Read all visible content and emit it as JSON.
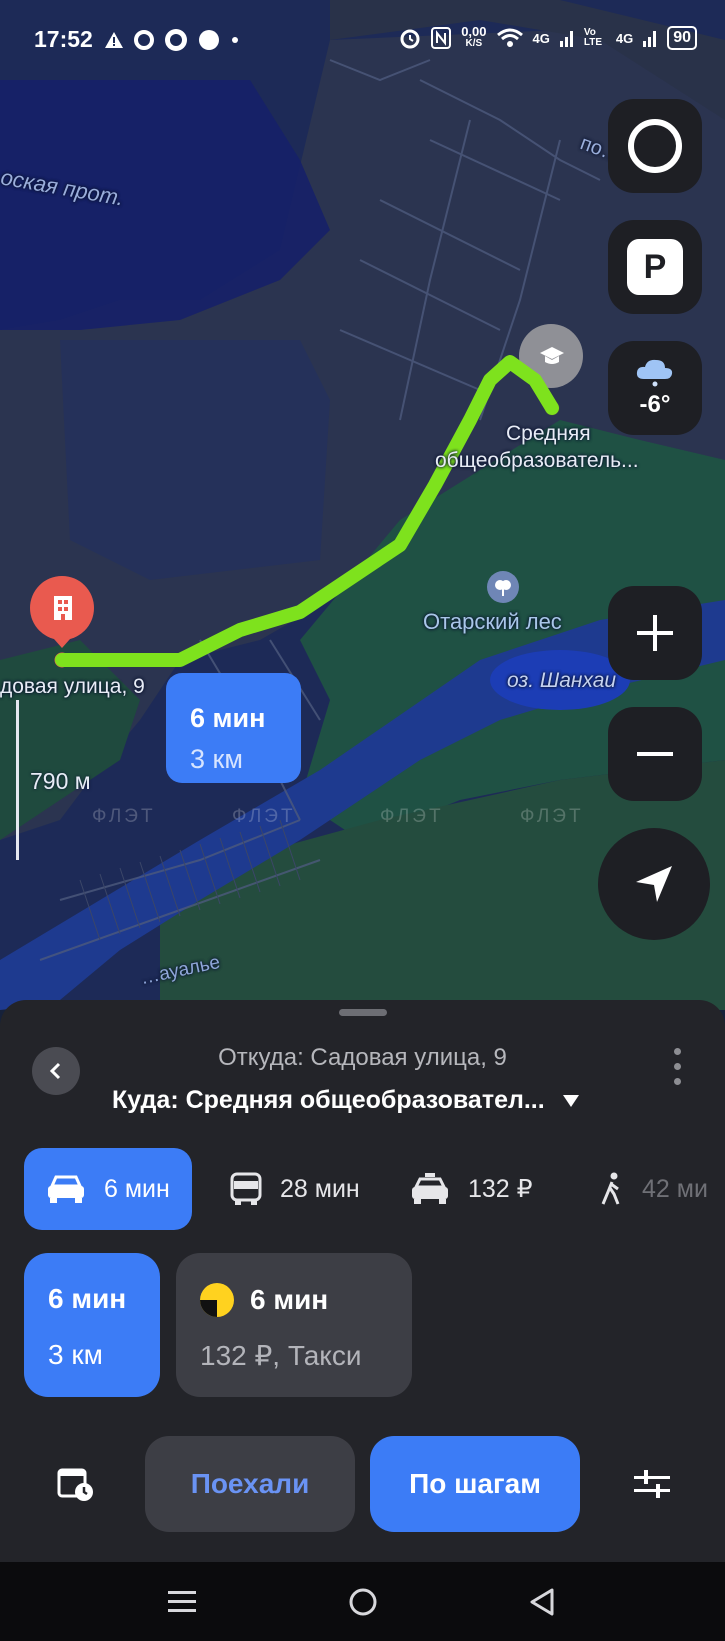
{
  "status_bar": {
    "time": "17:52",
    "net_speed_value": "0,00",
    "net_speed_unit": "K/S",
    "net_1": "4G",
    "volte": "Vo LTE",
    "net_2": "4G",
    "battery": "90"
  },
  "map": {
    "labels": {
      "channel": "оская прот.",
      "top_street": "по…чно-О",
      "destination": "Средняя",
      "destination_line2": "общеобразователь...",
      "forest": "Отарский лес",
      "lake": "оз. Шанхаи",
      "origin": "довая улица, 9",
      "bottom_street": "…ауалье"
    },
    "weather_temp": "-6°",
    "parking_label": "P",
    "scale": "790 м",
    "route_badge": {
      "time": "6 мин",
      "distance": "3 км"
    },
    "watermark": "ФЛЭТ"
  },
  "panel": {
    "from": "Откуда: Садовая улица, 9",
    "to": "Куда: Средняя общеобразовател...",
    "modes": [
      {
        "label": "6 мин",
        "icon": "car-icon"
      },
      {
        "label": "28 мин",
        "icon": "bus-icon"
      },
      {
        "label": "132 ₽",
        "icon": "taxi-icon"
      },
      {
        "label": "42 ми",
        "icon": "walk-icon"
      }
    ],
    "options": {
      "car": {
        "time": "6 мин",
        "distance": "3 км"
      },
      "taxi": {
        "time": "6 мин",
        "price": "132 ₽, Такси"
      }
    },
    "buttons": {
      "go": "Поехали",
      "steps": "По шагам"
    }
  },
  "colors": {
    "accent": "#3c7cf6",
    "route": "#7ee21d",
    "panel_bg": "#232429",
    "origin_pin": "#e95a4f"
  }
}
